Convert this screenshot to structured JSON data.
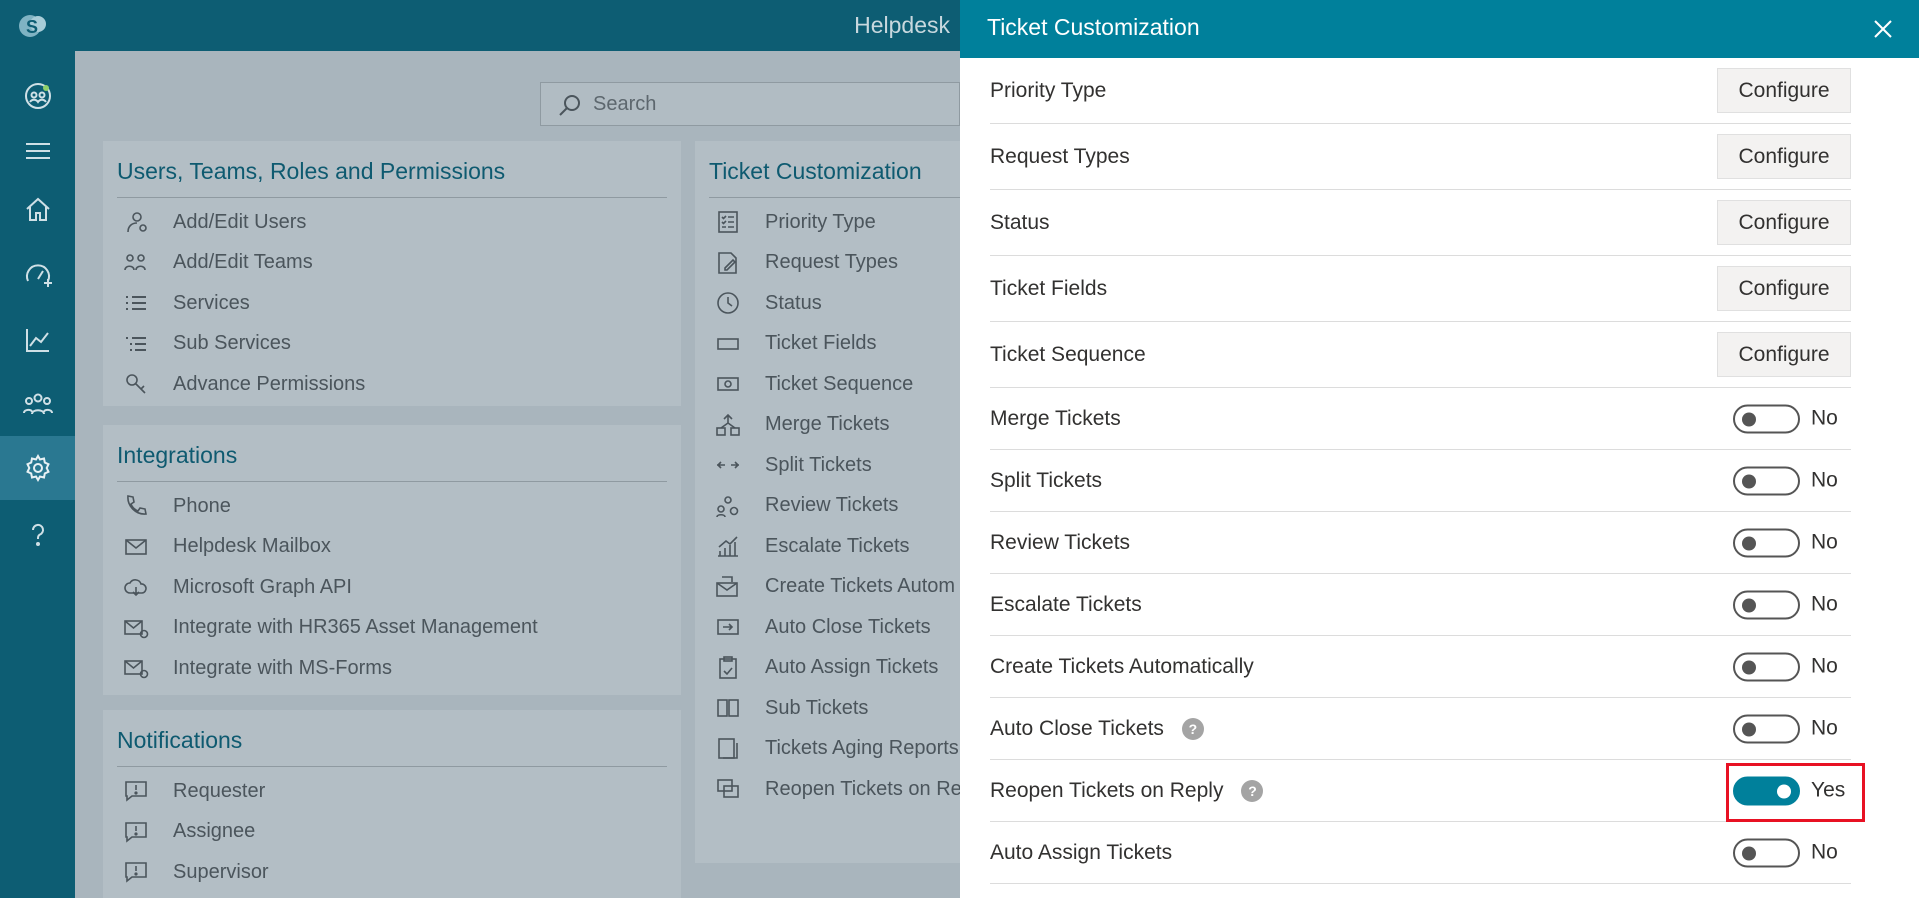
{
  "topbar": {
    "title": "Helpdesk"
  },
  "search": {
    "placeholder": "Search"
  },
  "sections": [
    {
      "title": "Users, Teams, Roles and Permissions",
      "items": [
        {
          "label": "Add/Edit Users",
          "icon": "user-icon"
        },
        {
          "label": "Add/Edit Teams",
          "icon": "team-icon"
        },
        {
          "label": "Services",
          "icon": "list-icon"
        },
        {
          "label": "Sub Services",
          "icon": "sublist-icon"
        },
        {
          "label": "Advance Permissions",
          "icon": "key-icon"
        }
      ]
    },
    {
      "title": "Integrations",
      "items": [
        {
          "label": "Phone",
          "icon": "phone-icon"
        },
        {
          "label": "Helpdesk Mailbox",
          "icon": "mail-icon"
        },
        {
          "label": "Microsoft Graph API",
          "icon": "cloud-icon"
        },
        {
          "label": "Integrate with HR365 Asset Management",
          "icon": "mail-sync-icon"
        },
        {
          "label": "Integrate with MS-Forms",
          "icon": "mail-sync-icon"
        }
      ]
    },
    {
      "title": "Notifications",
      "items": [
        {
          "label": "Requester",
          "icon": "alert-message-icon"
        },
        {
          "label": "Assignee",
          "icon": "alert-message-icon"
        },
        {
          "label": "Supervisor",
          "icon": "alert-message-icon"
        }
      ]
    },
    {
      "title": "Ticket Customization",
      "items": [
        {
          "label": "Priority Type",
          "icon": "checklist-icon"
        },
        {
          "label": "Request Types",
          "icon": "edit-doc-icon"
        },
        {
          "label": "Status",
          "icon": "clock-icon"
        },
        {
          "label": "Ticket Fields",
          "icon": "field-icon"
        },
        {
          "label": "Ticket Sequence",
          "icon": "number-icon"
        },
        {
          "label": "Merge Tickets",
          "icon": "merge-icon"
        },
        {
          "label": "Split Tickets",
          "icon": "split-icon"
        },
        {
          "label": "Review Tickets",
          "icon": "review-icon"
        },
        {
          "label": "Escalate Tickets",
          "icon": "escalate-icon"
        },
        {
          "label": "Create Tickets Autom",
          "icon": "mail-create-icon"
        },
        {
          "label": "Auto Close Tickets",
          "icon": "exit-icon"
        },
        {
          "label": "Auto Assign Tickets",
          "icon": "clipboard-icon"
        },
        {
          "label": "Sub Tickets",
          "icon": "columns-icon"
        },
        {
          "label": "Tickets Aging Reports",
          "icon": "doc-icon"
        },
        {
          "label": "Reopen Tickets on Re",
          "icon": "reopen-icon"
        }
      ]
    }
  ],
  "panel": {
    "title": "Ticket Customization",
    "configure_label": "Configure",
    "configure_rows": [
      {
        "label": "Priority Type"
      },
      {
        "label": "Request Types"
      },
      {
        "label": "Status"
      },
      {
        "label": "Ticket Fields"
      },
      {
        "label": "Ticket Sequence"
      }
    ],
    "toggle_rows": [
      {
        "label": "Merge Tickets",
        "value": "No",
        "on": false,
        "help": false
      },
      {
        "label": "Split Tickets",
        "value": "No",
        "on": false,
        "help": false
      },
      {
        "label": "Review Tickets",
        "value": "No",
        "on": false,
        "help": false
      },
      {
        "label": "Escalate Tickets",
        "value": "No",
        "on": false,
        "help": false
      },
      {
        "label": "Create Tickets Automatically",
        "value": "No",
        "on": false,
        "help": false
      },
      {
        "label": "Auto Close Tickets",
        "value": "No",
        "on": false,
        "help": true
      },
      {
        "label": "Reopen Tickets on Reply",
        "value": "Yes",
        "on": true,
        "help": true,
        "highlighted": true
      },
      {
        "label": "Auto Assign Tickets",
        "value": "No",
        "on": false,
        "help": false
      }
    ],
    "help_glyph": "?"
  },
  "colors": {
    "rail": "#0d5d73",
    "accent": "#00809b",
    "highlight": "#e81123"
  }
}
